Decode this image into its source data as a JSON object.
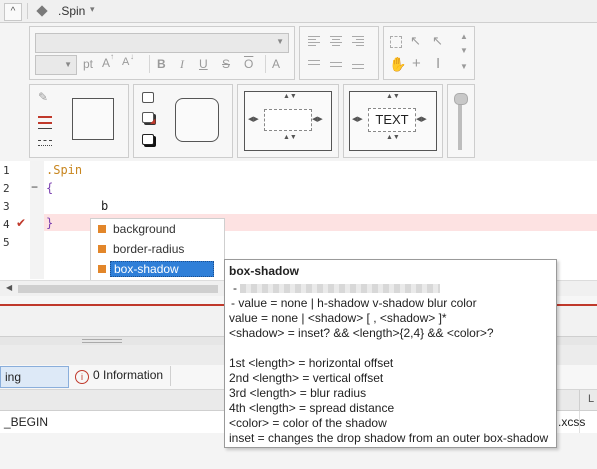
{
  "tab": {
    "title": ".Spin",
    "collapse_glyph": "^",
    "caret_glyph": "▾"
  },
  "ribbon": {
    "font_size_placeholder": "",
    "unit_label": "pt",
    "grow_font": "A",
    "shrink_font": "A",
    "bold": "B",
    "italic": "I",
    "underline": "U",
    "strikethrough": "S",
    "overline": "O",
    "text_color": "A",
    "text_preview_label": "TEXT"
  },
  "editor": {
    "line_numbers": [
      "1",
      "2",
      "3",
      "4",
      "5"
    ],
    "lines": [
      ".Spin",
      "{",
      "b",
      "}",
      ""
    ],
    "error_mark": "✔",
    "fold_mark": "−"
  },
  "autocomplete": {
    "items": [
      "background",
      "border-radius",
      "box-shadow"
    ],
    "selected_index": 2
  },
  "tooltip": {
    "title": "box-shadow",
    "lines": [
      "-",
      "- value = none | h-shadow v-shadow blur color",
      "value = none | <shadow> [ , <shadow> ]*",
      "<shadow> = inset? && <length>{2,4} && <color>?",
      "",
      "1st <length> = horizontal offset",
      "2nd <length> = vertical offset",
      "3rd <length> = blur radius",
      "4th <length> = spread distance",
      "<color> = color of the shadow",
      "inset = changes the drop shadow from an outer box-shadow"
    ]
  },
  "lower": {
    "warnings_label": "ing",
    "info_label": "0 Information",
    "info_icon": "i",
    "row_text": "_BEGIN",
    "row_ext": ".xcss",
    "header_tail": "L"
  },
  "colors": {
    "error_bg": "#fde2e2",
    "accent_select": "#2f7fd8",
    "square_orange": "#e2862a",
    "code_orange": "#c8861f",
    "brace_purple": "#7a3fb0"
  }
}
